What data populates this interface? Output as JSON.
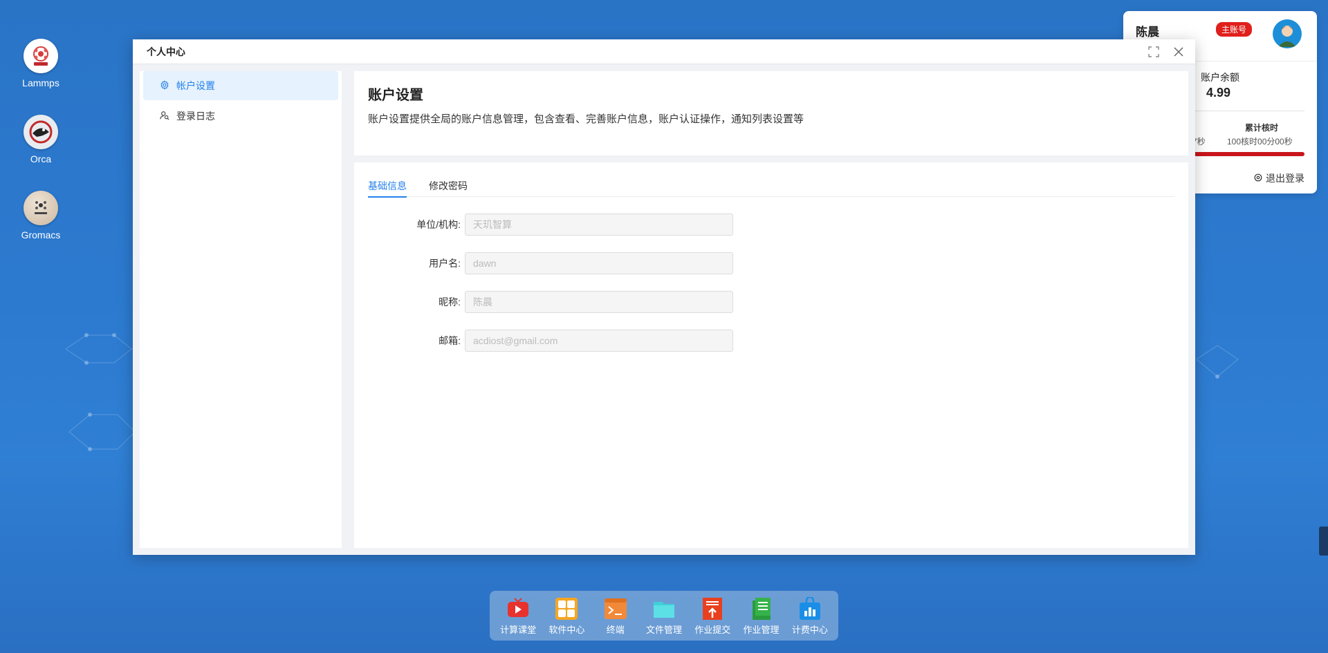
{
  "desktop": {
    "icons": [
      {
        "label": "Lammps",
        "icon": "lammps-icon"
      },
      {
        "label": "Orca",
        "icon": "orca-icon"
      },
      {
        "label": "Gromacs",
        "icon": "gromacs-icon"
      }
    ]
  },
  "user_panel": {
    "name": "陈晨",
    "badge": "主账号",
    "balance_label": "账户余额",
    "balance_value": "4.99",
    "core_hours_label": "累计核时",
    "core_hours_partial": "7秒",
    "core_hours_value": "100核时00分00秒",
    "logout_label": "退出登录"
  },
  "window": {
    "title": "个人中心",
    "sidebar": {
      "items": [
        {
          "label": "帐户设置",
          "icon": "gear-icon",
          "active": true
        },
        {
          "label": "登录日志",
          "icon": "user-search-icon",
          "active": false
        }
      ]
    },
    "header": {
      "title": "账户设置",
      "description": "账户设置提供全局的账户信息管理，包含查看、完善账户信息，账户认证操作，通知列表设置等"
    },
    "tabs": [
      {
        "label": "基础信息",
        "active": true
      },
      {
        "label": "修改密码",
        "active": false
      }
    ],
    "form": {
      "fields": [
        {
          "label": "单位/机构:",
          "placeholder": "天玑智算"
        },
        {
          "label": "用户名:",
          "placeholder": "dawn"
        },
        {
          "label": "昵称:",
          "placeholder": "陈晨"
        },
        {
          "label": "邮箱:",
          "placeholder": "acdiost@gmail.com"
        }
      ]
    }
  },
  "taskbar": {
    "items": [
      {
        "label": "计算课堂",
        "icon": "tv-play-icon",
        "color": "#e8322e"
      },
      {
        "label": "软件中心",
        "icon": "grid-apps-icon",
        "color": "#f5a623"
      },
      {
        "label": "终端",
        "icon": "terminal-icon",
        "color": "#f08a3a"
      },
      {
        "label": "文件管理",
        "icon": "folder-icon",
        "color": "#3fd0d8"
      },
      {
        "label": "作业提交",
        "icon": "upload-doc-icon",
        "color": "#e8401e"
      },
      {
        "label": "作业管理",
        "icon": "doc-list-icon",
        "color": "#35b34a"
      },
      {
        "label": "计费中心",
        "icon": "bag-chart-icon",
        "color": "#1a8ee6"
      }
    ]
  },
  "colors": {
    "accent": "#2680eb",
    "badge": "#e0201c",
    "desktop": "#2c7ad0"
  }
}
